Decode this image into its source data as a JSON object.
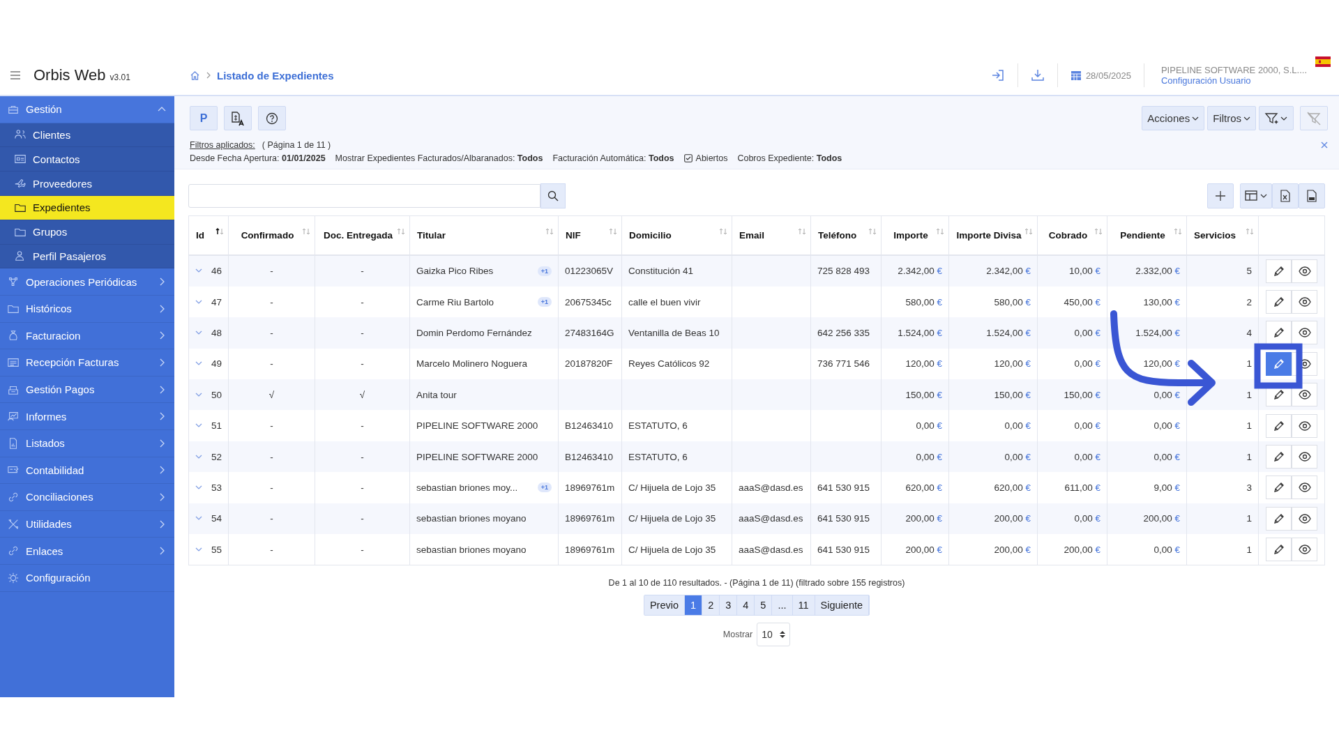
{
  "app": {
    "name": "Orbis Web",
    "version": "v3.01"
  },
  "breadcrumb": {
    "current": "Listado de Expedientes"
  },
  "header": {
    "date": "28/05/2025",
    "company": "PIPELINE SOFTWARE 2000, S.L....",
    "user_link": "Configuración Usuario"
  },
  "sidebar": {
    "items": [
      {
        "label": "Gestión",
        "expanded": true,
        "children": [
          {
            "label": "Clientes",
            "selected": false
          },
          {
            "label": "Contactos",
            "selected": false
          },
          {
            "label": "Proveedores",
            "selected": false
          },
          {
            "label": "Expedientes",
            "selected": true
          },
          {
            "label": "Grupos",
            "selected": false
          },
          {
            "label": "Perfil Pasajeros",
            "selected": false
          }
        ]
      },
      {
        "label": "Operaciones Periódicas",
        "expanded": false
      },
      {
        "label": "Históricos",
        "expanded": false
      },
      {
        "label": "Facturacion",
        "expanded": false
      },
      {
        "label": "Recepción Facturas",
        "expanded": false
      },
      {
        "label": "Gestión Pagos",
        "expanded": false
      },
      {
        "label": "Informes",
        "expanded": false
      },
      {
        "label": "Listados",
        "expanded": false
      },
      {
        "label": "Contabilidad",
        "expanded": false
      },
      {
        "label": "Conciliaciones",
        "expanded": false
      },
      {
        "label": "Utilidades",
        "expanded": false
      },
      {
        "label": "Enlaces",
        "expanded": false
      },
      {
        "label": "Configuración"
      }
    ]
  },
  "toolbar": {
    "p_button": "P",
    "menus": [
      "Acciones",
      "Filtros"
    ]
  },
  "filters": {
    "title": "Filtros aplicados:",
    "page_info": "( Página 1 de 11 )",
    "items": [
      {
        "label": "Desde Fecha Apertura:",
        "value": "01/01/2025"
      },
      {
        "label": "Mostrar Expedientes Facturados/Albaranados:",
        "value": "Todos"
      },
      {
        "label": "Facturación Automática:",
        "value": "Todos"
      },
      {
        "label": "Abiertos",
        "checked": true
      },
      {
        "label": "Cobros Expediente:",
        "value": "Todos"
      }
    ]
  },
  "table": {
    "currency": "€",
    "columns": [
      {
        "label": "Id",
        "kind": "id",
        "sorted": true
      },
      {
        "label": "Confirmado",
        "kind": "center",
        "sorted": false
      },
      {
        "label": "Doc. Entregada",
        "kind": "center",
        "sorted": false
      },
      {
        "label": "Titular",
        "kind": "titular",
        "sorted": false
      },
      {
        "label": "NIF",
        "kind": "text",
        "sorted": false
      },
      {
        "label": "Domicilio",
        "kind": "text",
        "sorted": false
      },
      {
        "label": "Email",
        "kind": "text",
        "sorted": false
      },
      {
        "label": "Teléfono",
        "kind": "text",
        "sorted": false
      },
      {
        "label": "Importe",
        "kind": "money",
        "sorted": false
      },
      {
        "label": "Importe Divisa",
        "kind": "money",
        "sorted": false
      },
      {
        "label": "Cobrado",
        "kind": "money",
        "sorted": false
      },
      {
        "label": "Pendiente",
        "kind": "money",
        "sorted": false
      },
      {
        "label": "Servicios",
        "kind": "number",
        "sorted": false
      }
    ],
    "rows": [
      {
        "cells": [
          "46",
          "-",
          "-",
          "Gaizka Pico Ribes",
          "01223065V",
          "Constitución 41",
          "",
          "725 828 493",
          "2.342,00",
          "2.342,00",
          "10,00",
          "2.332,00",
          "5"
        ],
        "badge": "+1",
        "highlighted": false
      },
      {
        "cells": [
          "47",
          "-",
          "-",
          "Carme Riu Bartolo",
          "20675345c",
          "calle el buen vivir",
          "",
          "",
          "580,00",
          "580,00",
          "450,00",
          "130,00",
          "2"
        ],
        "badge": "+1",
        "highlighted": false
      },
      {
        "cells": [
          "48",
          "-",
          "-",
          "Domin Perdomo Fernández",
          "27483164G",
          "Ventanilla de Beas 10",
          "",
          "642 256 335",
          "1.524,00",
          "1.524,00",
          "0,00",
          "1.524,00",
          "4"
        ],
        "highlighted": false
      },
      {
        "cells": [
          "49",
          "-",
          "-",
          "Marcelo Molinero Noguera",
          "20187820F",
          "Reyes Católicos 92",
          "",
          "736 771 546",
          "120,00",
          "120,00",
          "0,00",
          "120,00",
          "1"
        ],
        "highlighted": true
      },
      {
        "cells": [
          "50",
          "√",
          "√",
          "Anita tour",
          "",
          "",
          "",
          "",
          "150,00",
          "150,00",
          "150,00",
          "0,00",
          "1"
        ],
        "highlighted": false
      },
      {
        "cells": [
          "51",
          "-",
          "-",
          "PIPELINE SOFTWARE 2000",
          "B12463410",
          "ESTATUTO, 6",
          "",
          "",
          "0,00",
          "0,00",
          "0,00",
          "0,00",
          "1"
        ],
        "highlighted": false
      },
      {
        "cells": [
          "52",
          "-",
          "-",
          "PIPELINE SOFTWARE 2000",
          "B12463410",
          "ESTATUTO, 6",
          "",
          "",
          "0,00",
          "0,00",
          "0,00",
          "0,00",
          "1"
        ],
        "highlighted": false
      },
      {
        "cells": [
          "53",
          "-",
          "-",
          "sebastian briones moy...",
          "18969761m",
          "C/ Hijuela de Lojo 35",
          "aaaS@dasd.es",
          "641 530 915",
          "620,00",
          "620,00",
          "611,00",
          "9,00",
          "3"
        ],
        "badge": "+1",
        "highlighted": false
      },
      {
        "cells": [
          "54",
          "-",
          "-",
          "sebastian briones moyano",
          "18969761m",
          "C/ Hijuela de Lojo 35",
          "aaaS@dasd.es",
          "641 530 915",
          "200,00",
          "200,00",
          "0,00",
          "200,00",
          "1"
        ],
        "highlighted": false
      },
      {
        "cells": [
          "55",
          "-",
          "-",
          "sebastian briones moyano",
          "18969761m",
          "C/ Hijuela de Lojo 35",
          "aaaS@dasd.es",
          "641 530 915",
          "200,00",
          "200,00",
          "200,00",
          "0,00",
          "1"
        ],
        "highlighted": false
      }
    ]
  },
  "summary": "De 1 al 10 de 110 resultados. - (Página 1 de 11) (filtrado sobre 155 registros)",
  "pagination": {
    "prev": "Previo",
    "next": "Siguiente",
    "pages": [
      {
        "label": "1",
        "selected": true
      },
      {
        "label": "2",
        "selected": false
      },
      {
        "label": "3",
        "selected": false
      },
      {
        "label": "4",
        "selected": false
      },
      {
        "label": "5",
        "selected": false
      },
      {
        "label": "...",
        "selected": false
      },
      {
        "label": "11",
        "selected": false
      }
    ]
  },
  "page_size": {
    "label": "Mostrar",
    "value": "10"
  }
}
